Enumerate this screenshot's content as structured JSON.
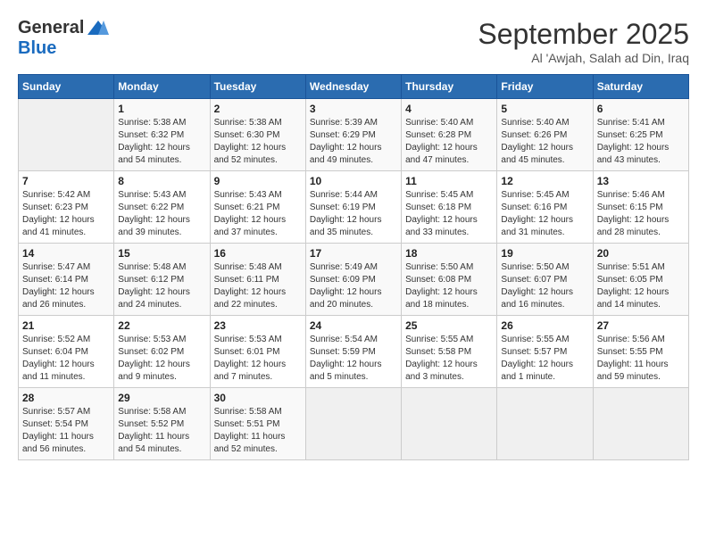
{
  "logo": {
    "line1": "General",
    "line2": "Blue"
  },
  "title": "September 2025",
  "subtitle": "Al 'Awjah, Salah ad Din, Iraq",
  "days_of_week": [
    "Sunday",
    "Monday",
    "Tuesday",
    "Wednesday",
    "Thursday",
    "Friday",
    "Saturday"
  ],
  "weeks": [
    [
      {
        "day": "",
        "sunrise": "",
        "sunset": "",
        "daylight": "",
        "empty": true
      },
      {
        "day": "1",
        "sunrise": "Sunrise: 5:38 AM",
        "sunset": "Sunset: 6:32 PM",
        "daylight": "Daylight: 12 hours and 54 minutes."
      },
      {
        "day": "2",
        "sunrise": "Sunrise: 5:38 AM",
        "sunset": "Sunset: 6:30 PM",
        "daylight": "Daylight: 12 hours and 52 minutes."
      },
      {
        "day": "3",
        "sunrise": "Sunrise: 5:39 AM",
        "sunset": "Sunset: 6:29 PM",
        "daylight": "Daylight: 12 hours and 49 minutes."
      },
      {
        "day": "4",
        "sunrise": "Sunrise: 5:40 AM",
        "sunset": "Sunset: 6:28 PM",
        "daylight": "Daylight: 12 hours and 47 minutes."
      },
      {
        "day": "5",
        "sunrise": "Sunrise: 5:40 AM",
        "sunset": "Sunset: 6:26 PM",
        "daylight": "Daylight: 12 hours and 45 minutes."
      },
      {
        "day": "6",
        "sunrise": "Sunrise: 5:41 AM",
        "sunset": "Sunset: 6:25 PM",
        "daylight": "Daylight: 12 hours and 43 minutes."
      }
    ],
    [
      {
        "day": "7",
        "sunrise": "Sunrise: 5:42 AM",
        "sunset": "Sunset: 6:23 PM",
        "daylight": "Daylight: 12 hours and 41 minutes."
      },
      {
        "day": "8",
        "sunrise": "Sunrise: 5:43 AM",
        "sunset": "Sunset: 6:22 PM",
        "daylight": "Daylight: 12 hours and 39 minutes."
      },
      {
        "day": "9",
        "sunrise": "Sunrise: 5:43 AM",
        "sunset": "Sunset: 6:21 PM",
        "daylight": "Daylight: 12 hours and 37 minutes."
      },
      {
        "day": "10",
        "sunrise": "Sunrise: 5:44 AM",
        "sunset": "Sunset: 6:19 PM",
        "daylight": "Daylight: 12 hours and 35 minutes."
      },
      {
        "day": "11",
        "sunrise": "Sunrise: 5:45 AM",
        "sunset": "Sunset: 6:18 PM",
        "daylight": "Daylight: 12 hours and 33 minutes."
      },
      {
        "day": "12",
        "sunrise": "Sunrise: 5:45 AM",
        "sunset": "Sunset: 6:16 PM",
        "daylight": "Daylight: 12 hours and 31 minutes."
      },
      {
        "day": "13",
        "sunrise": "Sunrise: 5:46 AM",
        "sunset": "Sunset: 6:15 PM",
        "daylight": "Daylight: 12 hours and 28 minutes."
      }
    ],
    [
      {
        "day": "14",
        "sunrise": "Sunrise: 5:47 AM",
        "sunset": "Sunset: 6:14 PM",
        "daylight": "Daylight: 12 hours and 26 minutes."
      },
      {
        "day": "15",
        "sunrise": "Sunrise: 5:48 AM",
        "sunset": "Sunset: 6:12 PM",
        "daylight": "Daylight: 12 hours and 24 minutes."
      },
      {
        "day": "16",
        "sunrise": "Sunrise: 5:48 AM",
        "sunset": "Sunset: 6:11 PM",
        "daylight": "Daylight: 12 hours and 22 minutes."
      },
      {
        "day": "17",
        "sunrise": "Sunrise: 5:49 AM",
        "sunset": "Sunset: 6:09 PM",
        "daylight": "Daylight: 12 hours and 20 minutes."
      },
      {
        "day": "18",
        "sunrise": "Sunrise: 5:50 AM",
        "sunset": "Sunset: 6:08 PM",
        "daylight": "Daylight: 12 hours and 18 minutes."
      },
      {
        "day": "19",
        "sunrise": "Sunrise: 5:50 AM",
        "sunset": "Sunset: 6:07 PM",
        "daylight": "Daylight: 12 hours and 16 minutes."
      },
      {
        "day": "20",
        "sunrise": "Sunrise: 5:51 AM",
        "sunset": "Sunset: 6:05 PM",
        "daylight": "Daylight: 12 hours and 14 minutes."
      }
    ],
    [
      {
        "day": "21",
        "sunrise": "Sunrise: 5:52 AM",
        "sunset": "Sunset: 6:04 PM",
        "daylight": "Daylight: 12 hours and 11 minutes."
      },
      {
        "day": "22",
        "sunrise": "Sunrise: 5:53 AM",
        "sunset": "Sunset: 6:02 PM",
        "daylight": "Daylight: 12 hours and 9 minutes."
      },
      {
        "day": "23",
        "sunrise": "Sunrise: 5:53 AM",
        "sunset": "Sunset: 6:01 PM",
        "daylight": "Daylight: 12 hours and 7 minutes."
      },
      {
        "day": "24",
        "sunrise": "Sunrise: 5:54 AM",
        "sunset": "Sunset: 5:59 PM",
        "daylight": "Daylight: 12 hours and 5 minutes."
      },
      {
        "day": "25",
        "sunrise": "Sunrise: 5:55 AM",
        "sunset": "Sunset: 5:58 PM",
        "daylight": "Daylight: 12 hours and 3 minutes."
      },
      {
        "day": "26",
        "sunrise": "Sunrise: 5:55 AM",
        "sunset": "Sunset: 5:57 PM",
        "daylight": "Daylight: 12 hours and 1 minute."
      },
      {
        "day": "27",
        "sunrise": "Sunrise: 5:56 AM",
        "sunset": "Sunset: 5:55 PM",
        "daylight": "Daylight: 11 hours and 59 minutes."
      }
    ],
    [
      {
        "day": "28",
        "sunrise": "Sunrise: 5:57 AM",
        "sunset": "Sunset: 5:54 PM",
        "daylight": "Daylight: 11 hours and 56 minutes."
      },
      {
        "day": "29",
        "sunrise": "Sunrise: 5:58 AM",
        "sunset": "Sunset: 5:52 PM",
        "daylight": "Daylight: 11 hours and 54 minutes."
      },
      {
        "day": "30",
        "sunrise": "Sunrise: 5:58 AM",
        "sunset": "Sunset: 5:51 PM",
        "daylight": "Daylight: 11 hours and 52 minutes."
      },
      {
        "day": "",
        "sunrise": "",
        "sunset": "",
        "daylight": "",
        "empty": true
      },
      {
        "day": "",
        "sunrise": "",
        "sunset": "",
        "daylight": "",
        "empty": true
      },
      {
        "day": "",
        "sunrise": "",
        "sunset": "",
        "daylight": "",
        "empty": true
      },
      {
        "day": "",
        "sunrise": "",
        "sunset": "",
        "daylight": "",
        "empty": true
      }
    ]
  ]
}
